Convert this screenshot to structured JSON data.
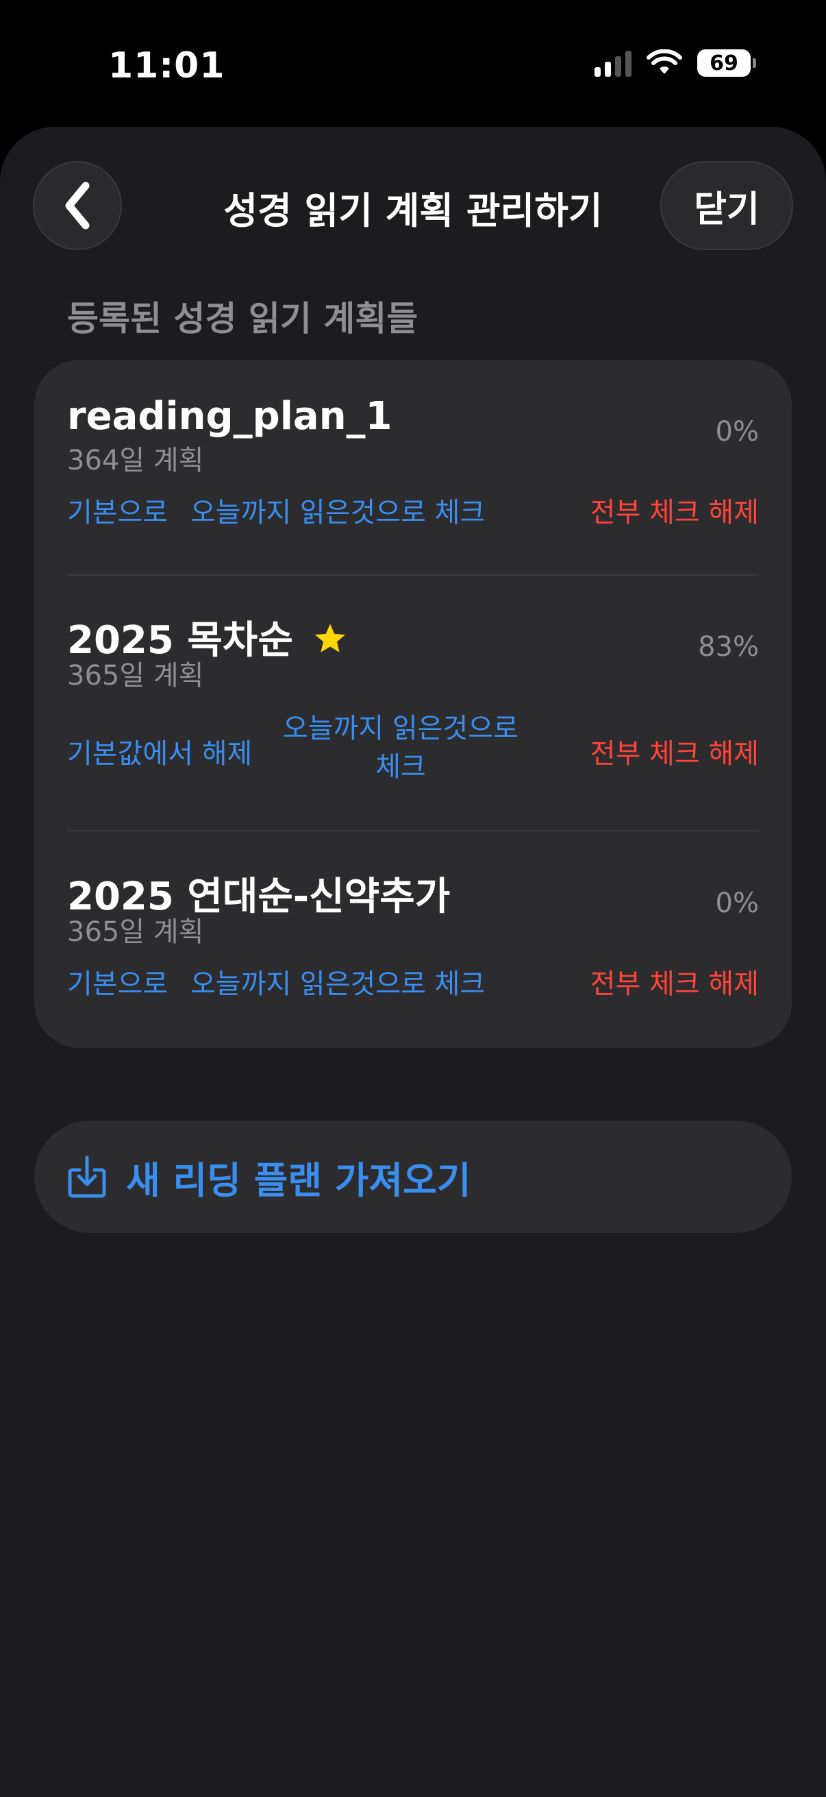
{
  "status": {
    "time": "11:01",
    "battery": "69"
  },
  "header": {
    "title": "성경 읽기 계획 관리하기",
    "close_label": "닫기"
  },
  "section_title": "등록된 성경 읽기 계획들",
  "plans": [
    {
      "name": "reading_plan_1",
      "days": "364일 계획",
      "percent": "0%",
      "action_default": "기본으로",
      "action_check": "오늘까지 읽은것으로 체크",
      "action_uncheck": "전부 체크 해제",
      "is_default": false
    },
    {
      "name": "2025 목차순",
      "days": "365일 계획",
      "percent": "83%",
      "action_default": "기본값에서 해제",
      "action_check": "오늘까지 읽은것으로 체크",
      "action_uncheck": "전부 체크 해제",
      "is_default": true
    },
    {
      "name": "2025 연대순-신약추가",
      "days": "365일 계획",
      "percent": "0%",
      "action_default": "기본으로",
      "action_check": "오늘까지 읽은것으로 체크",
      "action_uncheck": "전부 체크 해제",
      "is_default": false
    }
  ],
  "import_label": "새 리딩 플랜 가져오기",
  "colors": {
    "accent": "#3a8ef0",
    "destructive": "#ff453a",
    "star": "#ffd60a"
  }
}
